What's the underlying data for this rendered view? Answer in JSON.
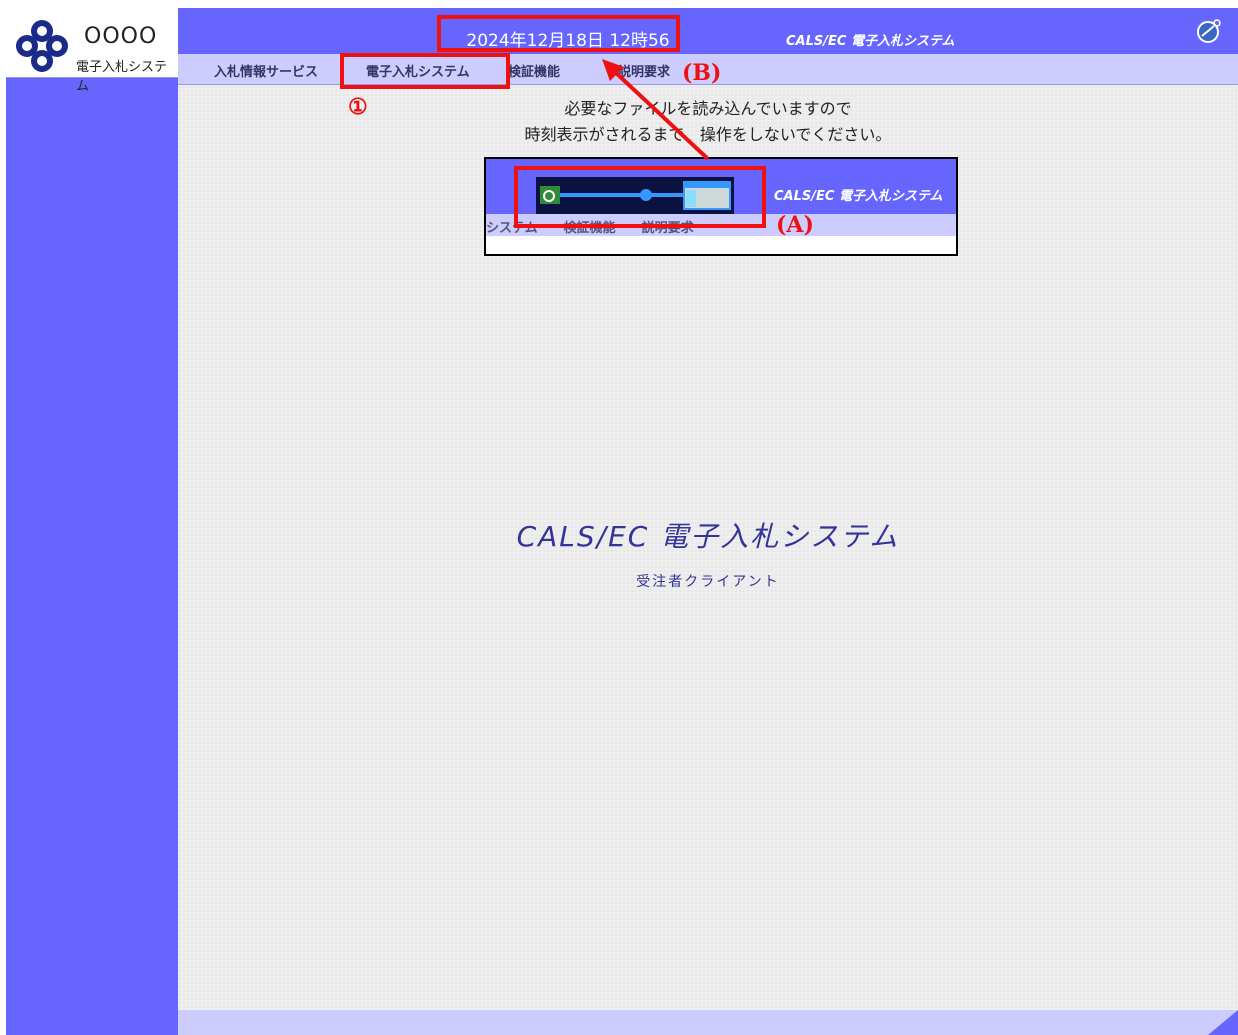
{
  "brand": {
    "org": "OOOO",
    "app": "電子入札システム"
  },
  "header": {
    "clock": "2024年12月18日 12時56分",
    "title": "CALS/EC 電子入札システム",
    "globe_icon": "globe-icon"
  },
  "menu": {
    "items": [
      {
        "label": "入札情報サービス"
      },
      {
        "label": "電子入札システム"
      },
      {
        "label": "検証機能"
      },
      {
        "label": "説明要求"
      }
    ]
  },
  "content": {
    "notice_line1": "必要なファイルを読み込んでいますので",
    "notice_line2": "時刻表示がされるまで、操作をしないでください。",
    "preview": {
      "title": "CALS/EC 電子入札システム",
      "menu_label": "システム　　検証機能　　説明要求"
    },
    "app_title": "CALS/EC 電子入札システム",
    "app_subtitle": "受注者クライアント"
  },
  "annotations": {
    "circle1": "①",
    "label_a": "(A)",
    "label_b": "(B)"
  },
  "colors": {
    "primary": "#6666ff",
    "menu": "#ccccff",
    "annotation": "#ee1111"
  }
}
